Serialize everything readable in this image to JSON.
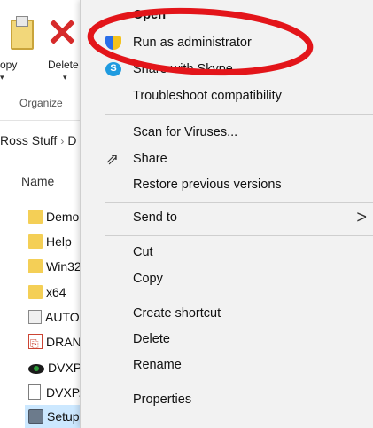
{
  "ribbon": {
    "copy_label": "opy",
    "copy_caret": "▾",
    "delete_label": "Delete",
    "delete_caret": "▾",
    "group_label": "Organize"
  },
  "breadcrumb": {
    "current": "Ross Stuff",
    "separator": "›",
    "next": "D"
  },
  "file_list": {
    "header_name": "Name",
    "items": [
      {
        "name": "DemoFi",
        "icon": "folder-icon"
      },
      {
        "name": "Help",
        "icon": "folder-icon"
      },
      {
        "name": "Win32",
        "icon": "folder-icon"
      },
      {
        "name": "x64",
        "icon": "folder-icon"
      },
      {
        "name": "AUTORU",
        "icon": "autorun-icon"
      },
      {
        "name": "DRANV",
        "icon": "pdf-icon"
      },
      {
        "name": "DVXP.ic",
        "icon": "eye-icon"
      },
      {
        "name": "DVXP.LI",
        "icon": "document-icon"
      },
      {
        "name": "Setup.exe",
        "icon": "setup-icon"
      }
    ]
  },
  "context_menu": {
    "items": [
      {
        "label": "Open",
        "icon": null,
        "bold": true
      },
      {
        "label": "Run as administrator",
        "icon": "shield-icon"
      },
      {
        "label": "Share with Skype",
        "icon": "skype-icon"
      },
      {
        "label": "Troubleshoot compatibility",
        "icon": null
      },
      {
        "label": "Scan for Viruses...",
        "icon": null
      },
      {
        "label": "Share",
        "icon": "share-icon"
      },
      {
        "label": "Restore previous versions",
        "icon": null
      },
      {
        "label": "Send to",
        "icon": null,
        "submenu_arrow": ">"
      },
      {
        "label": "Cut",
        "icon": null
      },
      {
        "label": "Copy",
        "icon": null
      },
      {
        "label": "Create shortcut",
        "icon": null
      },
      {
        "label": "Delete",
        "icon": null
      },
      {
        "label": "Rename",
        "icon": null
      },
      {
        "label": "Properties",
        "icon": null
      }
    ]
  },
  "colors": {
    "highlight_ellipse": "#e3151a",
    "selection": "#cce8ff",
    "menu_bg": "#f2f2f2"
  }
}
